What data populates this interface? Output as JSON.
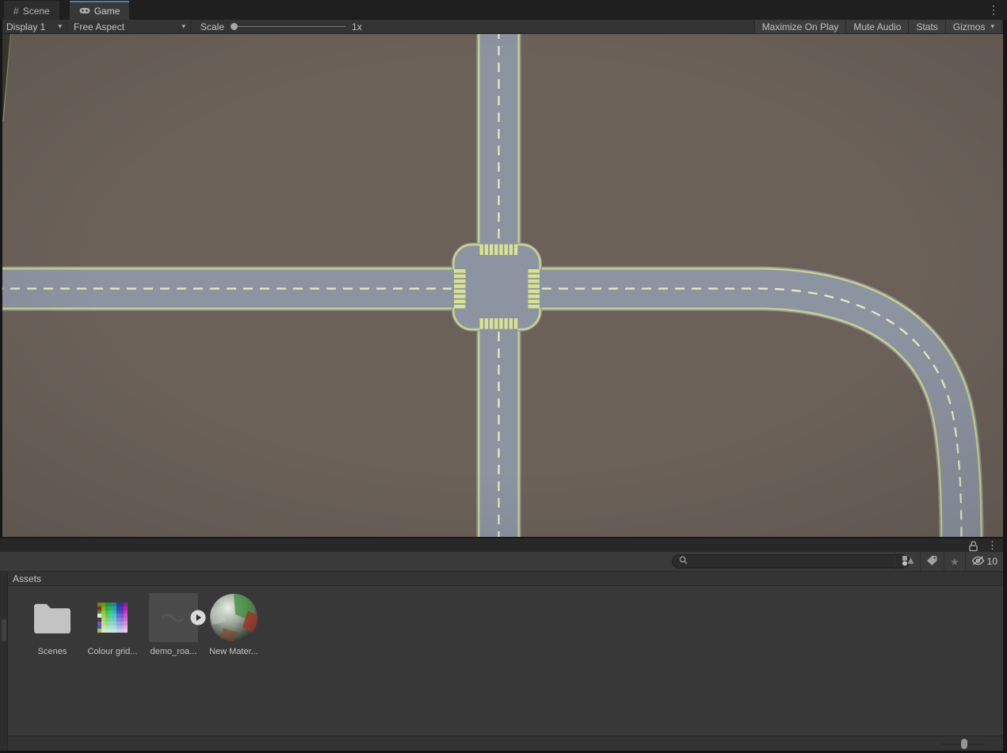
{
  "tabs": {
    "scene": "Scene",
    "game": "Game"
  },
  "toolbar": {
    "display": "Display 1",
    "aspect": "Free Aspect",
    "scale_label": "Scale",
    "scale_value": "1x",
    "maximize": "Maximize On Play",
    "mute": "Mute Audio",
    "stats": "Stats",
    "gizmos": "Gizmos"
  },
  "project": {
    "breadcrumb": "Assets",
    "search_placeholder": "",
    "search_value": "",
    "hidden_count": "10",
    "items": [
      {
        "name": "Scenes",
        "type": "folder"
      },
      {
        "name": "Colour grid...",
        "type": "texture"
      },
      {
        "name": "demo_roa...",
        "type": "video-clip"
      },
      {
        "name": "New Mater...",
        "type": "material"
      }
    ]
  },
  "scene_view": {
    "description": "Top-down four-way road intersection with zebra crosswalks; east arm curves south and exits bottom-right; small road sliver at top-left"
  },
  "colors": {
    "accent_blue": "#4a7fb5",
    "ground": "#6b6159",
    "road": "#8d94a1",
    "road_edge_line": "#c9d489",
    "road_dash_line": "#e6ecc0",
    "crosswalk": "#d9e293",
    "panel_bg": "#383838",
    "toolbar_bg": "#333333",
    "tabbar_bg": "#1f1f1f",
    "input_bg": "#2b2b2b",
    "text": "#c6c6c6"
  },
  "colour_grid_cells": [
    "#7e7d23",
    "hsl(81,60%,36%)",
    "hsl(117,60%,36%)",
    "hsl(153,60%,36%)",
    "hsl(189,60%,36%)",
    "hsl(225,60%,36%)",
    "hsl(261,60%,36%)",
    "hsl(297,60%,36%)",
    "#8a2a24",
    "hsl(81,58%,43%)",
    "hsl(117,58%,43%)",
    "hsl(153,58%,43%)",
    "hsl(189,58%,43%)",
    "hsl(225,58%,43%)",
    "hsl(261,58%,43%)",
    "hsl(297,58%,43%)",
    "#3a9634",
    "hsl(81,56%,50%)",
    "hsl(117,56%,50%)",
    "hsl(153,56%,50%)",
    "hsl(189,56%,50%)",
    "hsl(225,56%,50%)",
    "hsl(261,56%,50%)",
    "hsl(297,56%,50%)",
    "#e8e8e8",
    "hsl(81,54%,57%)",
    "hsl(117,54%,57%)",
    "hsl(153,54%,57%)",
    "hsl(189,54%,57%)",
    "hsl(225,54%,57%)",
    "hsl(261,54%,57%)",
    "hsl(297,54%,57%)",
    "#3f3f3f",
    "hsl(81,52%,64%)",
    "hsl(117,52%,64%)",
    "hsl(153,52%,64%)",
    "hsl(189,52%,64%)",
    "hsl(225,52%,64%)",
    "hsl(261,52%,64%)",
    "hsl(297,52%,64%)",
    "#7b4fb0",
    "hsl(81,50%,71%)",
    "hsl(117,50%,71%)",
    "hsl(153,50%,71%)",
    "hsl(189,50%,71%)",
    "hsl(225,50%,71%)",
    "hsl(261,50%,71%)",
    "hsl(297,50%,71%)",
    "#2b6db4",
    "hsl(81,48%,78%)",
    "hsl(117,48%,78%)",
    "hsl(153,48%,78%)",
    "hsl(189,48%,78%)",
    "hsl(225,48%,78%)",
    "hsl(261,48%,78%)",
    "hsl(297,48%,78%)",
    "#c2b043",
    "hsl(81,46%,85%)",
    "hsl(117,46%,85%)",
    "hsl(153,46%,85%)",
    "hsl(189,46%,85%)",
    "hsl(225,46%,85%)",
    "hsl(261,46%,85%)",
    "hsl(297,46%,85%)"
  ]
}
